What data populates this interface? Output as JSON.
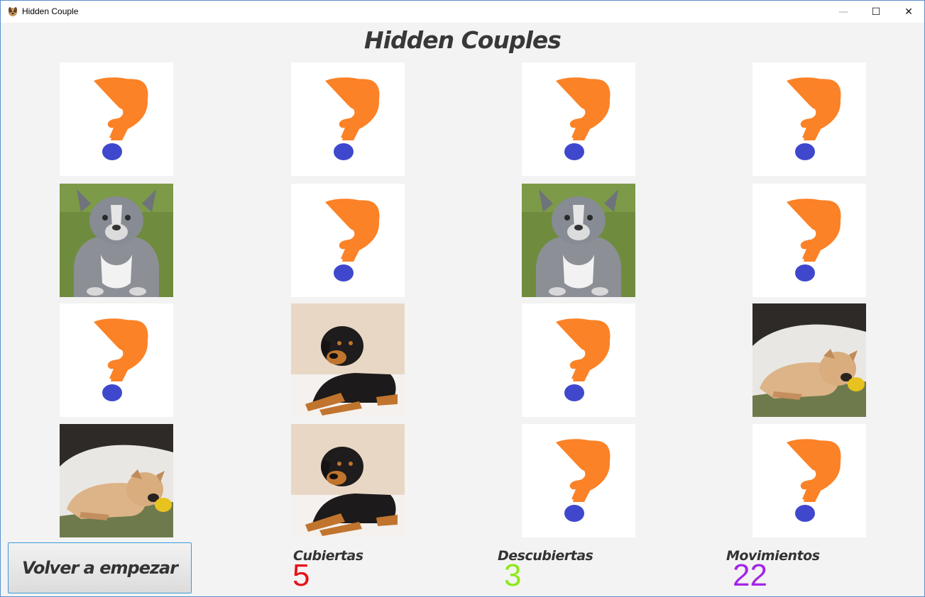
{
  "window": {
    "title": "Hidden Couple",
    "controls": {
      "minimize": "—",
      "maximize": "☐",
      "close": "✕"
    }
  },
  "game": {
    "title": "Hidden Couples"
  },
  "board": {
    "cards": [
      {
        "state": "hidden",
        "icon": "question-mark-icon"
      },
      {
        "state": "hidden",
        "icon": "question-mark-icon"
      },
      {
        "state": "hidden",
        "icon": "question-mark-icon"
      },
      {
        "state": "hidden",
        "icon": "question-mark-icon"
      },
      {
        "state": "revealed",
        "image": "pitbull-puppy"
      },
      {
        "state": "hidden",
        "icon": "question-mark-icon"
      },
      {
        "state": "revealed",
        "image": "pitbull-puppy"
      },
      {
        "state": "hidden",
        "icon": "question-mark-icon"
      },
      {
        "state": "hidden",
        "icon": "question-mark-icon"
      },
      {
        "state": "revealed",
        "image": "rottweiler-puppy"
      },
      {
        "state": "hidden",
        "icon": "question-mark-icon"
      },
      {
        "state": "revealed",
        "image": "sharpei-puppy"
      },
      {
        "state": "revealed",
        "image": "sharpei-puppy"
      },
      {
        "state": "revealed",
        "image": "rottweiler-puppy"
      },
      {
        "state": "hidden",
        "icon": "question-mark-icon"
      },
      {
        "state": "hidden",
        "icon": "question-mark-icon"
      }
    ]
  },
  "controls": {
    "restart_label": "Volver a empezar"
  },
  "stats": {
    "covered_label": "Cubiertas",
    "covered_value": "5",
    "covered_color": "#e8101a",
    "uncovered_label": "Descubiertas",
    "uncovered_value": "3",
    "uncovered_color": "#8ee81a",
    "moves_label": "Movimientos",
    "moves_value": "22",
    "moves_color": "#a425e8"
  },
  "colors": {
    "question_orange": "#fb8226",
    "question_dot": "#3f48cc",
    "card_back": "#ffffff",
    "background": "#f3f3f3"
  }
}
